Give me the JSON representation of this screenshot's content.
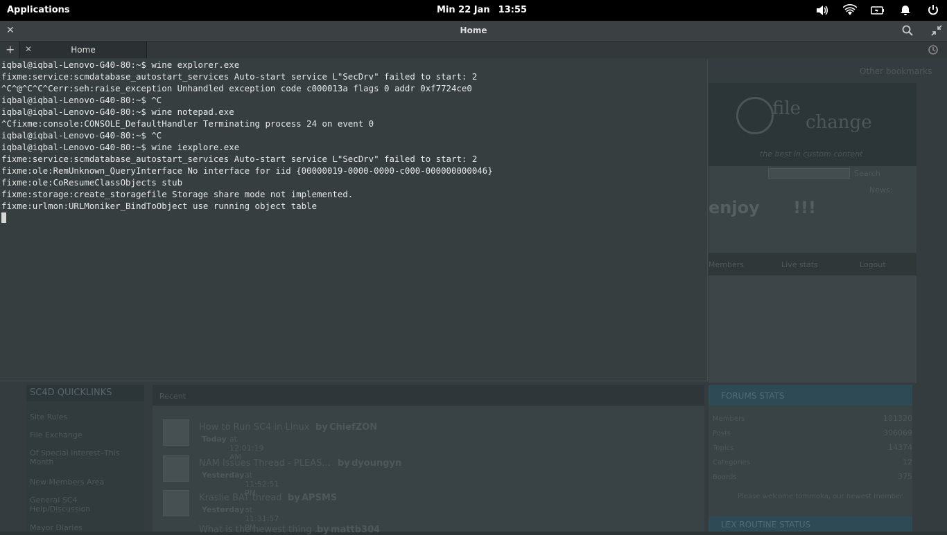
{
  "top_panel": {
    "applications_label": "Applications",
    "date": "Min 22 Jan",
    "time": "13:55",
    "icons": [
      "volume-icon",
      "wifi-icon",
      "battery-icon",
      "notification-bell-icon",
      "power-icon"
    ]
  },
  "window": {
    "title": "Home",
    "tab_label": "Home"
  },
  "terminal": {
    "lines": [
      "iqbal@iqbal-Lenovo-G40-80:~$ wine explorer.exe",
      "fixme:service:scmdatabase_autostart_services Auto-start service L\"SecDrv\" failed to start: 2",
      "^C^@^C^C^Cerr:seh:raise_exception Unhandled exception code c000013a flags 0 addr 0xf7724ce0",
      "iqbal@iqbal-Lenovo-G40-80:~$ ^C",
      "iqbal@iqbal-Lenovo-G40-80:~$ wine notepad.exe",
      "^Cfixme:console:CONSOLE_DefaultHandler Terminating process 24 on event 0",
      "iqbal@iqbal-Lenovo-G40-80:~$ ^C",
      "iqbal@iqbal-Lenovo-G40-80:~$ wine iexplore.exe",
      "fixme:service:scmdatabase_autostart_services Auto-start service L\"SecDrv\" failed to start: 2",
      "fixme:ole:RemUnknown_QueryInterface No interface for iid {00000019-0000-0000-c000-000000000046}",
      "fixme:ole:CoResumeClassObjects stub",
      "fixme:storage:create_storagefile Storage share mode not implemented.",
      "fixme:urlmon:URLMoniker_BindToObject use running object table"
    ]
  },
  "background_page": {
    "bookmarks": "Other bookmarks",
    "logo_word1": "file",
    "logo_word2": "change",
    "tagline": "the best in   custom content",
    "search_button": "Search",
    "news_label": "News:",
    "enjoy_text": "enjoy",
    "enjoy_suffix": "!!!",
    "nav_items": [
      "Members",
      "Live stats",
      "Logout"
    ],
    "quicklinks_title": "SC4D QUICKLINKS",
    "quicklinks": [
      "Site Rules",
      "File Exchange",
      "Of Special Interest–This Month",
      "New Members Area",
      "General SC4 Help/Discussion",
      "Mayor Diaries"
    ],
    "recent_title": "Recent",
    "recent_posts": [
      {
        "title": "How to Run SC4 in Linux",
        "by": "by",
        "author": "ChiefZON",
        "when_bold": "Today",
        "when_rest": "at 12:01:19 AM"
      },
      {
        "title": "NAM Issues Thread - PLEAS...",
        "by": "by",
        "author": "dyoungyn",
        "when_bold": "Yesterday",
        "when_rest": "at 11:52:51 PM"
      },
      {
        "title": "Kraslie BAT thread",
        "by": "by",
        "author": "APSMS",
        "when_bold": "Yesterday",
        "when_rest": "at 11:31:57 PM"
      },
      {
        "title": "What is the newest thing ...",
        "by": "by",
        "author": "mattb304",
        "when_bold": "",
        "when_rest": ""
      }
    ],
    "stats_title": "FORUMS STATS",
    "stats": [
      {
        "label": "Members",
        "value": "101320"
      },
      {
        "label": "Posts",
        "value": "306069"
      },
      {
        "label": "Topics",
        "value": "14374"
      },
      {
        "label": "Categories",
        "value": "12"
      },
      {
        "label": "Boards",
        "value": "375"
      }
    ],
    "welcome_text": "Please welcome tommoka, our newest member.",
    "latest_title": "LEX ROUTINE STATUS"
  }
}
